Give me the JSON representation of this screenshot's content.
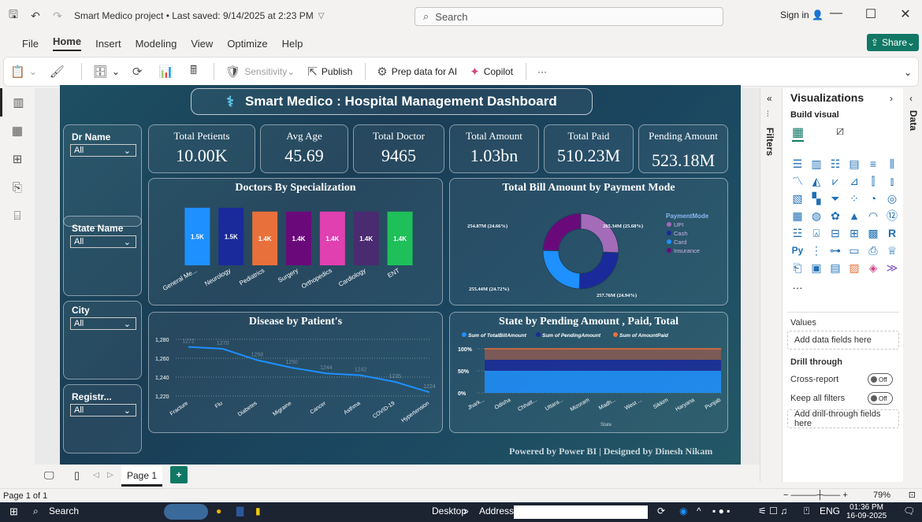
{
  "window": {
    "doc_title": "Smart Medico project • Last saved: 9/14/2025 at 2:23 PM",
    "search_placeholder": "Search",
    "signin": "Sign in"
  },
  "menu": [
    "File",
    "Home",
    "Insert",
    "Modeling",
    "View",
    "Optimize",
    "Help"
  ],
  "share_label": "Share",
  "ribbon": {
    "sensitivity": "Sensitivity",
    "publish": "Publish",
    "prep_data": "Prep data for AI",
    "copilot": "Copilot",
    "more": "···"
  },
  "dashboard": {
    "title": "Smart Medico : Hospital Management Dashboard",
    "slicers": [
      {
        "title": "Dr Name",
        "value": "All"
      },
      {
        "title": "State Name",
        "value": "All"
      },
      {
        "title": "City",
        "value": "All"
      },
      {
        "title": "Registr...",
        "value": "All"
      }
    ],
    "kpis": [
      {
        "title": "Total Petients",
        "value": "10.00K"
      },
      {
        "title": "Avg Age",
        "value": "45.69"
      },
      {
        "title": "Total Doctor",
        "value": "9465"
      },
      {
        "title": "Total Amount",
        "value": "1.03bn"
      },
      {
        "title": "Total Paid",
        "value": "510.23M"
      },
      {
        "title": "Pending Amount",
        "value": "523.18M"
      }
    ],
    "footer": "Powered by Power BI | Designed by Dinesh Nikam"
  },
  "chart_data": [
    {
      "type": "bar",
      "title": "Doctors By Specialization",
      "categories": [
        "General Me...",
        "Neurology",
        "Pediatrics",
        "Surgery",
        "Orthopedics",
        "Cardiology",
        "ENT"
      ],
      "values": [
        1500,
        1500,
        1400,
        1400,
        1400,
        1400,
        1400
      ],
      "labels": [
        "1.5K",
        "1.5K",
        "1.4K",
        "1.4K",
        "1.4K",
        "1.4K",
        "1.4K"
      ],
      "colors": [
        "#1e90ff",
        "#1a2a9a",
        "#e8703a",
        "#6a0a7a",
        "#e040b0",
        "#4a2a70",
        "#1fbf5a"
      ],
      "ylim": [
        0,
        1600
      ]
    },
    {
      "type": "pie",
      "title": "Total Bill Amount by Payment Mode",
      "legend_title": "PaymentMode",
      "slices": [
        {
          "name": "UPI",
          "value": 265.34,
          "label": "265.34M (25.68%)",
          "color": "#a36bb8"
        },
        {
          "name": "Cash",
          "value": 257.76,
          "label": "257.76M (24.94%)",
          "color": "#1a2a9a"
        },
        {
          "name": "Card",
          "value": 255.44,
          "label": "255.44M (24.72%)",
          "color": "#1e90ff"
        },
        {
          "name": "Insurance",
          "value": 254.87,
          "label": "254.87M (24.66%)",
          "color": "#6a0a7a"
        }
      ]
    },
    {
      "type": "line",
      "title": "Disease by Patient's",
      "categories": [
        "Fracture",
        "Flu",
        "Diabetes",
        "Migraine",
        "Cancer",
        "Asthma",
        "COVID-19",
        "Hypertension"
      ],
      "values": [
        1272,
        1270,
        1258,
        1250,
        1244,
        1242,
        1235,
        1224
      ],
      "yticks": [
        "1,280",
        "1,260",
        "1,240",
        "1,220"
      ],
      "ylim": [
        1220,
        1285
      ],
      "color": "#1e90ff"
    },
    {
      "type": "area",
      "title": "State by Pending Amount , Paid, Total",
      "legend": [
        "Sum of TotalBillAmount",
        "Sum of PendingAmount",
        "Sum of AmountPaid"
      ],
      "legend_colors": [
        "#1e90ff",
        "#1a2a9a",
        "#e8703a"
      ],
      "categories": [
        "Jhark...",
        "Odisha",
        "Chhatt...",
        "Uttara...",
        "Mizoram",
        "Madh...",
        "West ...",
        "Sikkim",
        "Haryana",
        "Punjab"
      ],
      "yticks": [
        "100%",
        "50%",
        "0%"
      ],
      "xlabel": "State"
    }
  ],
  "panes": {
    "filters": "Filters",
    "visualizations": "Visualizations",
    "build_visual": "Build visual",
    "values": "Values",
    "add_data_fields": "Add data fields here",
    "drill_through": "Drill through",
    "cross_report": "Cross-report",
    "keep_filters": "Keep all filters",
    "toggle_off": "Off",
    "add_drill": "Add drill-through fields here",
    "data": "Data"
  },
  "page_tab": "Page 1",
  "status": {
    "page": "Page 1 of 1",
    "zoom": "79%"
  },
  "taskbar": {
    "search": "Search",
    "desktop": "Desktop",
    "address": "Address",
    "lang": "ENG",
    "time": "01:36 PM",
    "date": "16-09-2025"
  }
}
